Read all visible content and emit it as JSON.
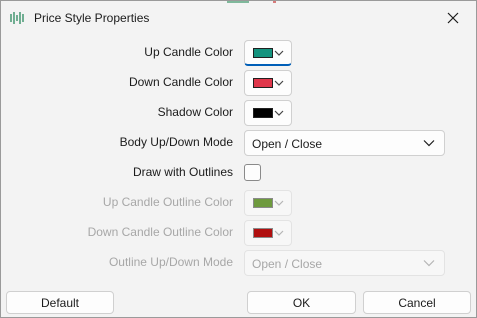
{
  "window": {
    "title": "Price Style Properties",
    "icon": "candlestick-chart-icon"
  },
  "colors": {
    "accent": "#005fb8",
    "up_candle": "#14937e",
    "down_candle": "#e0374b",
    "shadow": "#000000",
    "up_outline": "#6e9a3e",
    "down_outline": "#b00f0f"
  },
  "fields": {
    "up_candle_color": {
      "label": "Up Candle Color",
      "enabled": true
    },
    "down_candle_color": {
      "label": "Down Candle Color",
      "enabled": true
    },
    "shadow_color": {
      "label": "Shadow Color",
      "enabled": true
    },
    "body_mode": {
      "label": "Body Up/Down Mode",
      "value": "Open / Close",
      "enabled": true
    },
    "draw_outlines": {
      "label": "Draw with Outlines",
      "checked": false
    },
    "up_outline_color": {
      "label": "Up Candle Outline Color",
      "enabled": false
    },
    "down_outline_color": {
      "label": "Down Candle Outline Color",
      "enabled": false
    },
    "outline_mode": {
      "label": "Outline Up/Down Mode",
      "value": "Open / Close",
      "enabled": false
    }
  },
  "buttons": {
    "default": "Default",
    "ok": "OK",
    "cancel": "Cancel"
  }
}
